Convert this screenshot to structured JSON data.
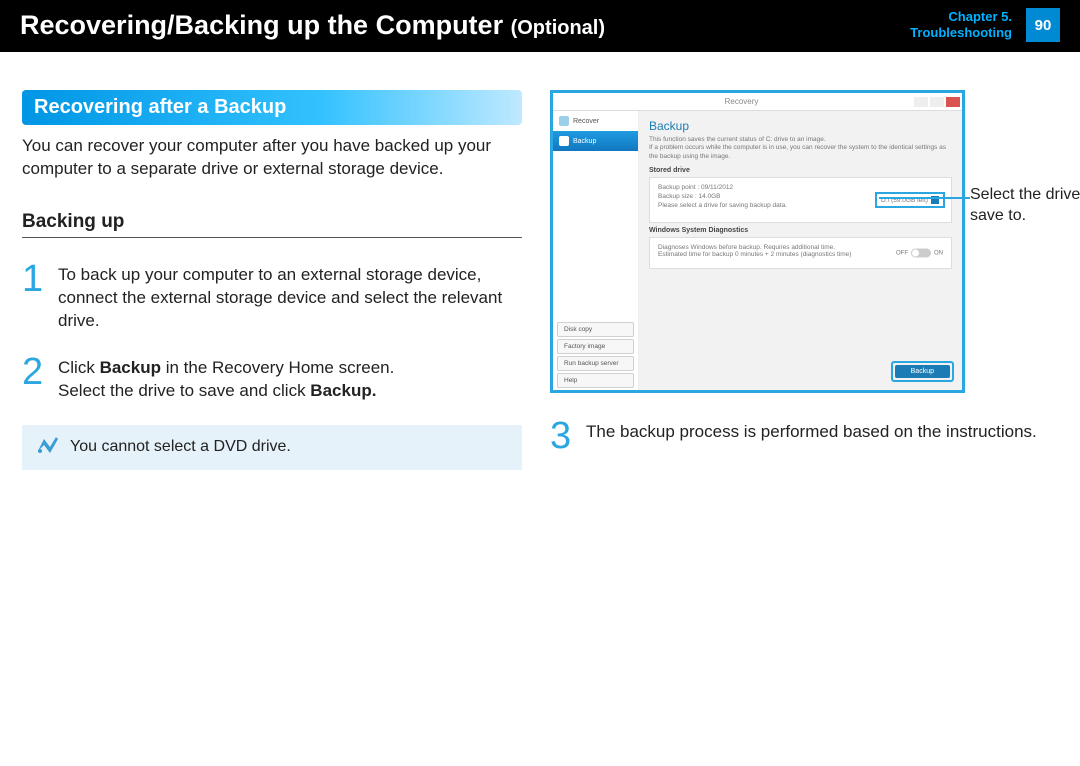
{
  "header": {
    "title_main": "Recovering/Backing up the Computer",
    "title_opt": "(Optional)",
    "chapter_line1": "Chapter 5.",
    "chapter_line2": "Troubleshooting",
    "page_number": "90"
  },
  "section_banner": "Recovering after a Backup",
  "intro_para": "You can recover your computer after you have backed up your computer to a separate drive or external storage device.",
  "subhead": "Backing up",
  "steps": {
    "s1_num": "1",
    "s1_text": "To back up your computer to an external storage device, connect the external storage device and select the relevant drive.",
    "s2_num": "2",
    "s2_text_a": "Click ",
    "s2_bold_a": "Backup",
    "s2_text_b": " in the Recovery Home screen.",
    "s2_text_c": "Select the drive to save and click ",
    "s2_bold_b": "Backup.",
    "s3_num": "3",
    "s3_text": "The backup process is performed based on the instructions."
  },
  "note_text": "You cannot select a DVD drive.",
  "callout": "Select the drive to save to.",
  "screenshot": {
    "window_title": "Recovery",
    "nav_recover": "Recover",
    "nav_backup": "Backup",
    "nav_disk_copy": "Disk copy",
    "nav_factory": "Factory image",
    "nav_run": "Run backup server",
    "nav_help": "Help",
    "pane_title": "Backup",
    "pane_desc": "This function saves the current status of C: drive to an image.\nIf a problem occurs while the computer is in use, you can recover the system to the identical settings as the backup using the image.",
    "stored_label": "Stored drive",
    "backup_point": "Backup point : 09/11/2012",
    "backup_size": "Backup size : 14.0GB",
    "select_drive_prompt": "Please select a drive for saving backup data.",
    "drive_selected": "D:\\ (59.0GB left)",
    "diag_label": "Windows System Diagnostics",
    "diag_text": "Diagnoses Windows before backup. Requires additional time.\nEstimated time for backup 0 minutes + 2 minutes (diagnostics time)",
    "off": "OFF",
    "on": "ON",
    "backup_button": "Backup"
  }
}
